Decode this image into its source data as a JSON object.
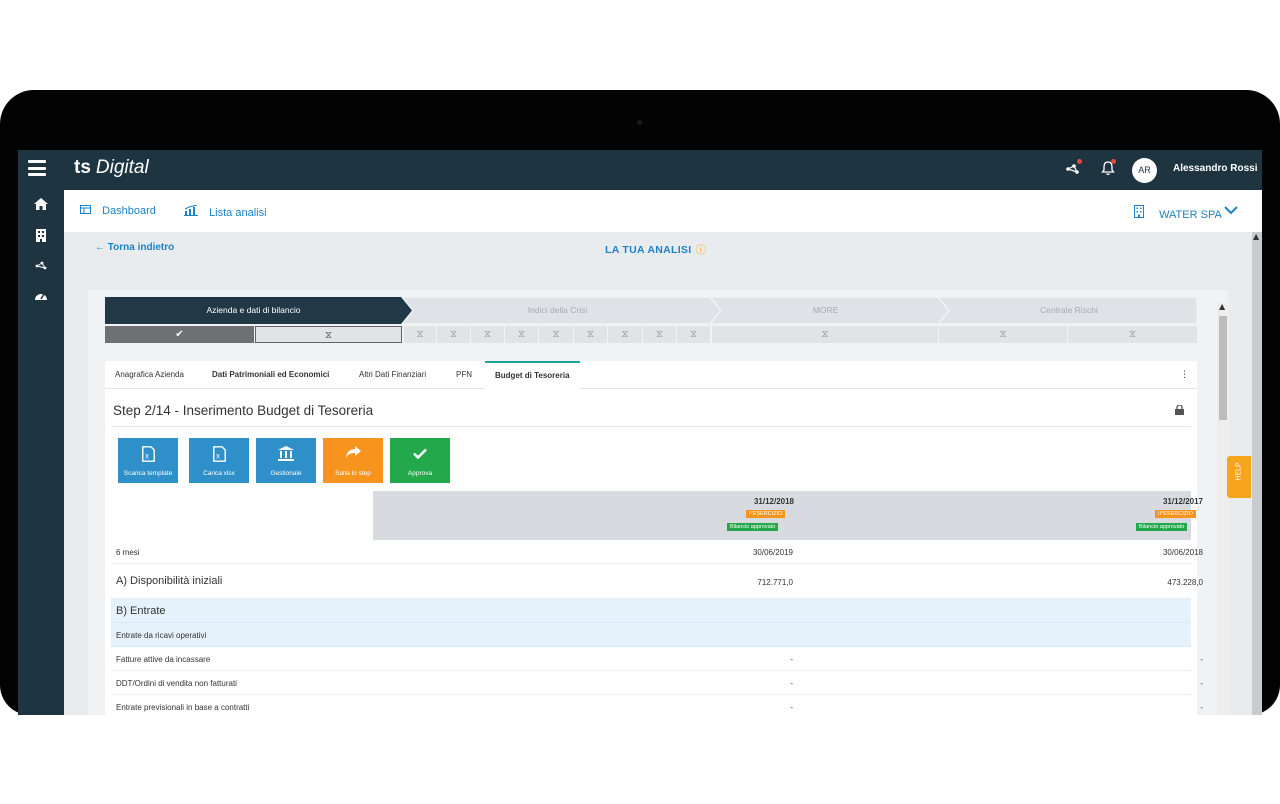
{
  "app": {
    "logo_mark": "ts",
    "logo_text": "Digital",
    "user_initials": "AR",
    "user_name": "Alessandro Rossi"
  },
  "icons": {
    "menu": "hamburger-icon",
    "network": "network-icon",
    "bell": "bell-icon",
    "home": "home-icon",
    "building": "building-icon",
    "nodes": "nodes-icon",
    "gauge": "gauge-icon",
    "info": "info-icon",
    "lock": "lock-icon",
    "kebab": "kebab-icon"
  },
  "nav": {
    "dashboard": "Dashboard",
    "analyses": "Lista analisi",
    "company": "WATER SPA"
  },
  "page": {
    "back": "← Torna indietro",
    "title": "LA TUA ANALISI"
  },
  "stepper": {
    "steps": [
      "Azienda e dati di bilancio",
      "Indici della Crisi",
      "MORE",
      "Centrale Rischi"
    ],
    "check": "✔",
    "hourglass": "⧖"
  },
  "tabs": [
    "Anagrafica Azienda",
    "Dati Patrimoniali ed Economici",
    "Altri Dati Finanziari",
    "PFN",
    "Budget di Tesoreria"
  ],
  "step_title": "Step 2/14 - Inserimento Budget di Tesoreria",
  "actions": {
    "download": "Scarica template",
    "upload": "Carica xlsx",
    "management": "Gestionale",
    "skip": "Salta lo step",
    "approve": "Approva"
  },
  "columns": [
    {
      "date": "31/12/2018",
      "exercise": "I°ESERCIZIO",
      "status": "Bilancio approvato"
    },
    {
      "date": "31/12/2017",
      "exercise": "II°ESERCIZIO",
      "status": "Bilancio approvato"
    }
  ],
  "rows": {
    "period_label": "6 mesi",
    "period_values": [
      "30/06/2019",
      "30/06/2018"
    ],
    "opening_label": "A) Disponibilità iniziali",
    "opening_values": [
      "712.771,0",
      "473.228,0"
    ],
    "inflows_label": "B) Entrate",
    "operating_label": "Entrate da ricavi operativi",
    "items": [
      {
        "label": "Fatture attive da incassare",
        "values": [
          "-",
          "-"
        ]
      },
      {
        "label": "DDT/Ordini di vendita non fatturati",
        "values": [
          "-",
          "-"
        ]
      },
      {
        "label": "Entrate previsionali in base a contratti",
        "values": [
          "-",
          "-"
        ]
      }
    ]
  },
  "help": "HELP",
  "colors": {
    "navy": "#1f3441",
    "accent": "#1b82c5",
    "orange": "#f7941d",
    "green": "#23a94b",
    "teal": "#1ba39c"
  }
}
